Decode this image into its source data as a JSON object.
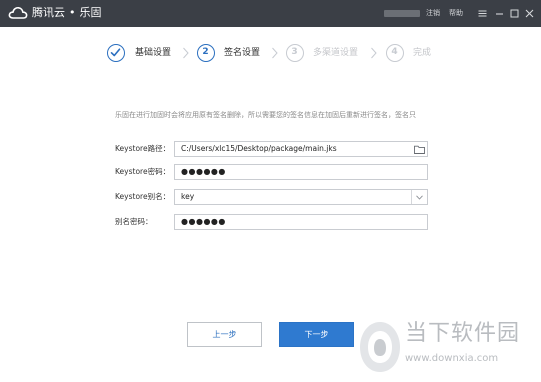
{
  "titlebar": {
    "brand_name": "腾讯云",
    "separator": "•",
    "app_name": "乐固",
    "logout_label": "注销",
    "help_label": "帮助",
    "bg_color": "#3b3f46"
  },
  "steps": [
    {
      "number": "",
      "label": "基础设置",
      "state": "done",
      "icon": "check-icon"
    },
    {
      "number": "2",
      "label": "签名设置",
      "state": "active"
    },
    {
      "number": "3",
      "label": "多渠道设置",
      "state": "pending"
    },
    {
      "number": "4",
      "label": "完成",
      "state": "pending"
    }
  ],
  "notice": "乐固在进行加固时会将应用原有签名删除，所以需要您的签名信息在加固后重新进行签名，签名只",
  "form": {
    "keystore_path": {
      "label": "Keystore路径：",
      "value": "C:/Users/xlc15/Desktop/package/main.jks",
      "icon": "folder-icon"
    },
    "keystore_password": {
      "label": "Keystore密码：",
      "value": "●●●●●●"
    },
    "keystore_alias": {
      "label": "Keystore别名：",
      "value": "key",
      "icon": "chevron-down-icon"
    },
    "alias_password": {
      "label": "别名密码：",
      "value": "●●●●●●"
    }
  },
  "buttons": {
    "prev_label": "上一步",
    "next_label": "下一步"
  },
  "watermark": {
    "text": "当下软件园",
    "url": "www.downxia.com"
  },
  "colors": {
    "accent": "#2f7ad0",
    "step_active": "#2b6fbf",
    "step_inactive": "#c7cbd1"
  }
}
